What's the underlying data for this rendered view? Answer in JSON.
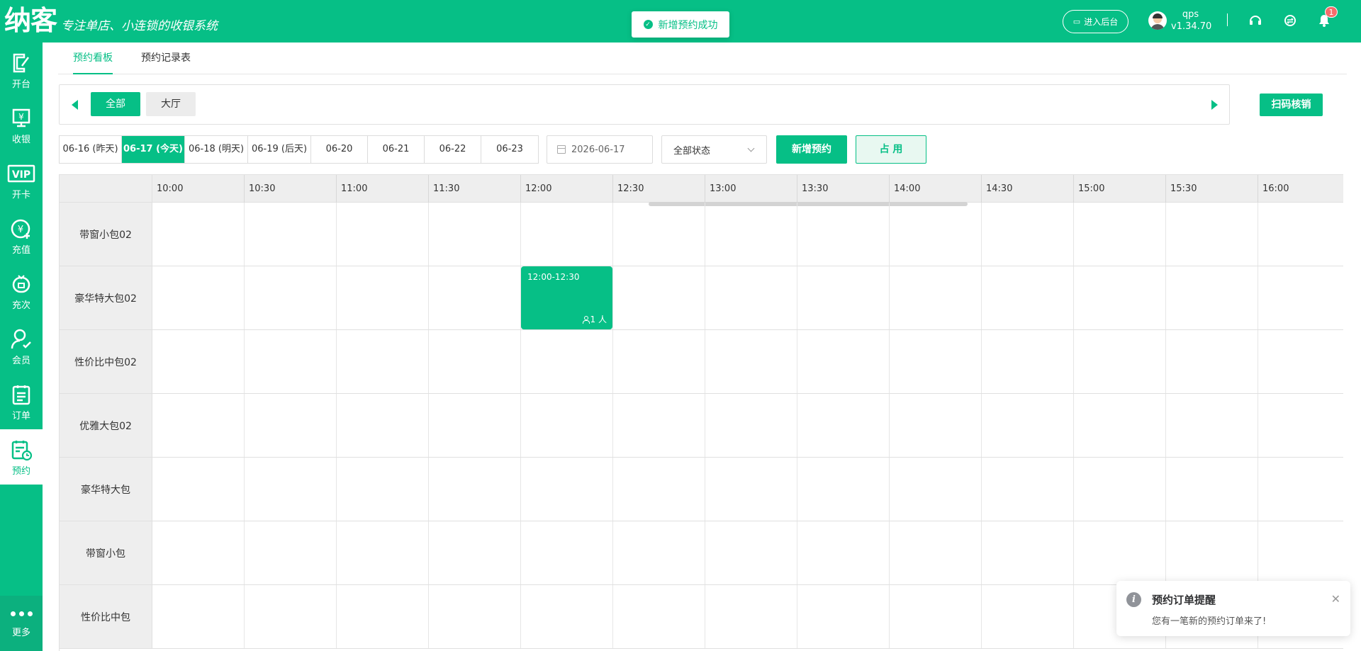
{
  "header": {
    "logo": "纳客",
    "slogan": "专注单店、小连锁的收银系统",
    "toast": "新增预约成功",
    "backend_button": "进入后台",
    "username": "qps",
    "version": "v1.34.70",
    "notification_count": "1"
  },
  "sidebar": {
    "items": [
      {
        "label": "开台",
        "icon": "open-table-icon"
      },
      {
        "label": "收银",
        "icon": "cashier-icon"
      },
      {
        "label": "开卡",
        "icon": "vip-card-icon"
      },
      {
        "label": "充值",
        "icon": "recharge-icon"
      },
      {
        "label": "充次",
        "icon": "recharge-times-icon"
      },
      {
        "label": "会员",
        "icon": "member-icon"
      },
      {
        "label": "订单",
        "icon": "order-icon"
      },
      {
        "label": "预约",
        "icon": "reservation-icon"
      }
    ],
    "more": "更多"
  },
  "tabs": [
    {
      "label": "预约看板",
      "active": true
    },
    {
      "label": "预约记录表",
      "active": false
    }
  ],
  "areas": [
    {
      "label": "全部",
      "active": true
    },
    {
      "label": "大厅",
      "active": false
    }
  ],
  "scan_button": "扫码核销",
  "dates": [
    {
      "label": "06-16 (昨天)",
      "active": false
    },
    {
      "label": "06-17 (今天)",
      "active": true
    },
    {
      "label": "06-18 (明天)",
      "active": false
    },
    {
      "label": "06-19 (后天)",
      "active": false
    },
    {
      "label": "06-20",
      "active": false
    },
    {
      "label": "06-21",
      "active": false
    },
    {
      "label": "06-22",
      "active": false
    },
    {
      "label": "06-23",
      "active": false
    }
  ],
  "date_picker": "2026-06-17",
  "status_select": "全部状态",
  "add_button": "新增预约",
  "occupy_button": "占 用",
  "times": [
    "10:00",
    "10:30",
    "11:00",
    "11:30",
    "12:00",
    "12:30",
    "13:00",
    "13:30",
    "14:00",
    "14:30",
    "15:00",
    "15:30",
    "16:00"
  ],
  "rooms": [
    "带窗小包02",
    "豪华特大包02",
    "性价比中包02",
    "优雅大包02",
    "豪华特大包",
    "带窗小包",
    "性价比中包"
  ],
  "booking": {
    "room": "豪华特大包02",
    "time": "12:00-12:30",
    "people": "1 人"
  },
  "notification": {
    "title": "预约订单提醒",
    "message": "您有一笔新的预约订单来了!"
  },
  "colors": {
    "brand": "#06bf86",
    "badge": "#f56c6c"
  }
}
